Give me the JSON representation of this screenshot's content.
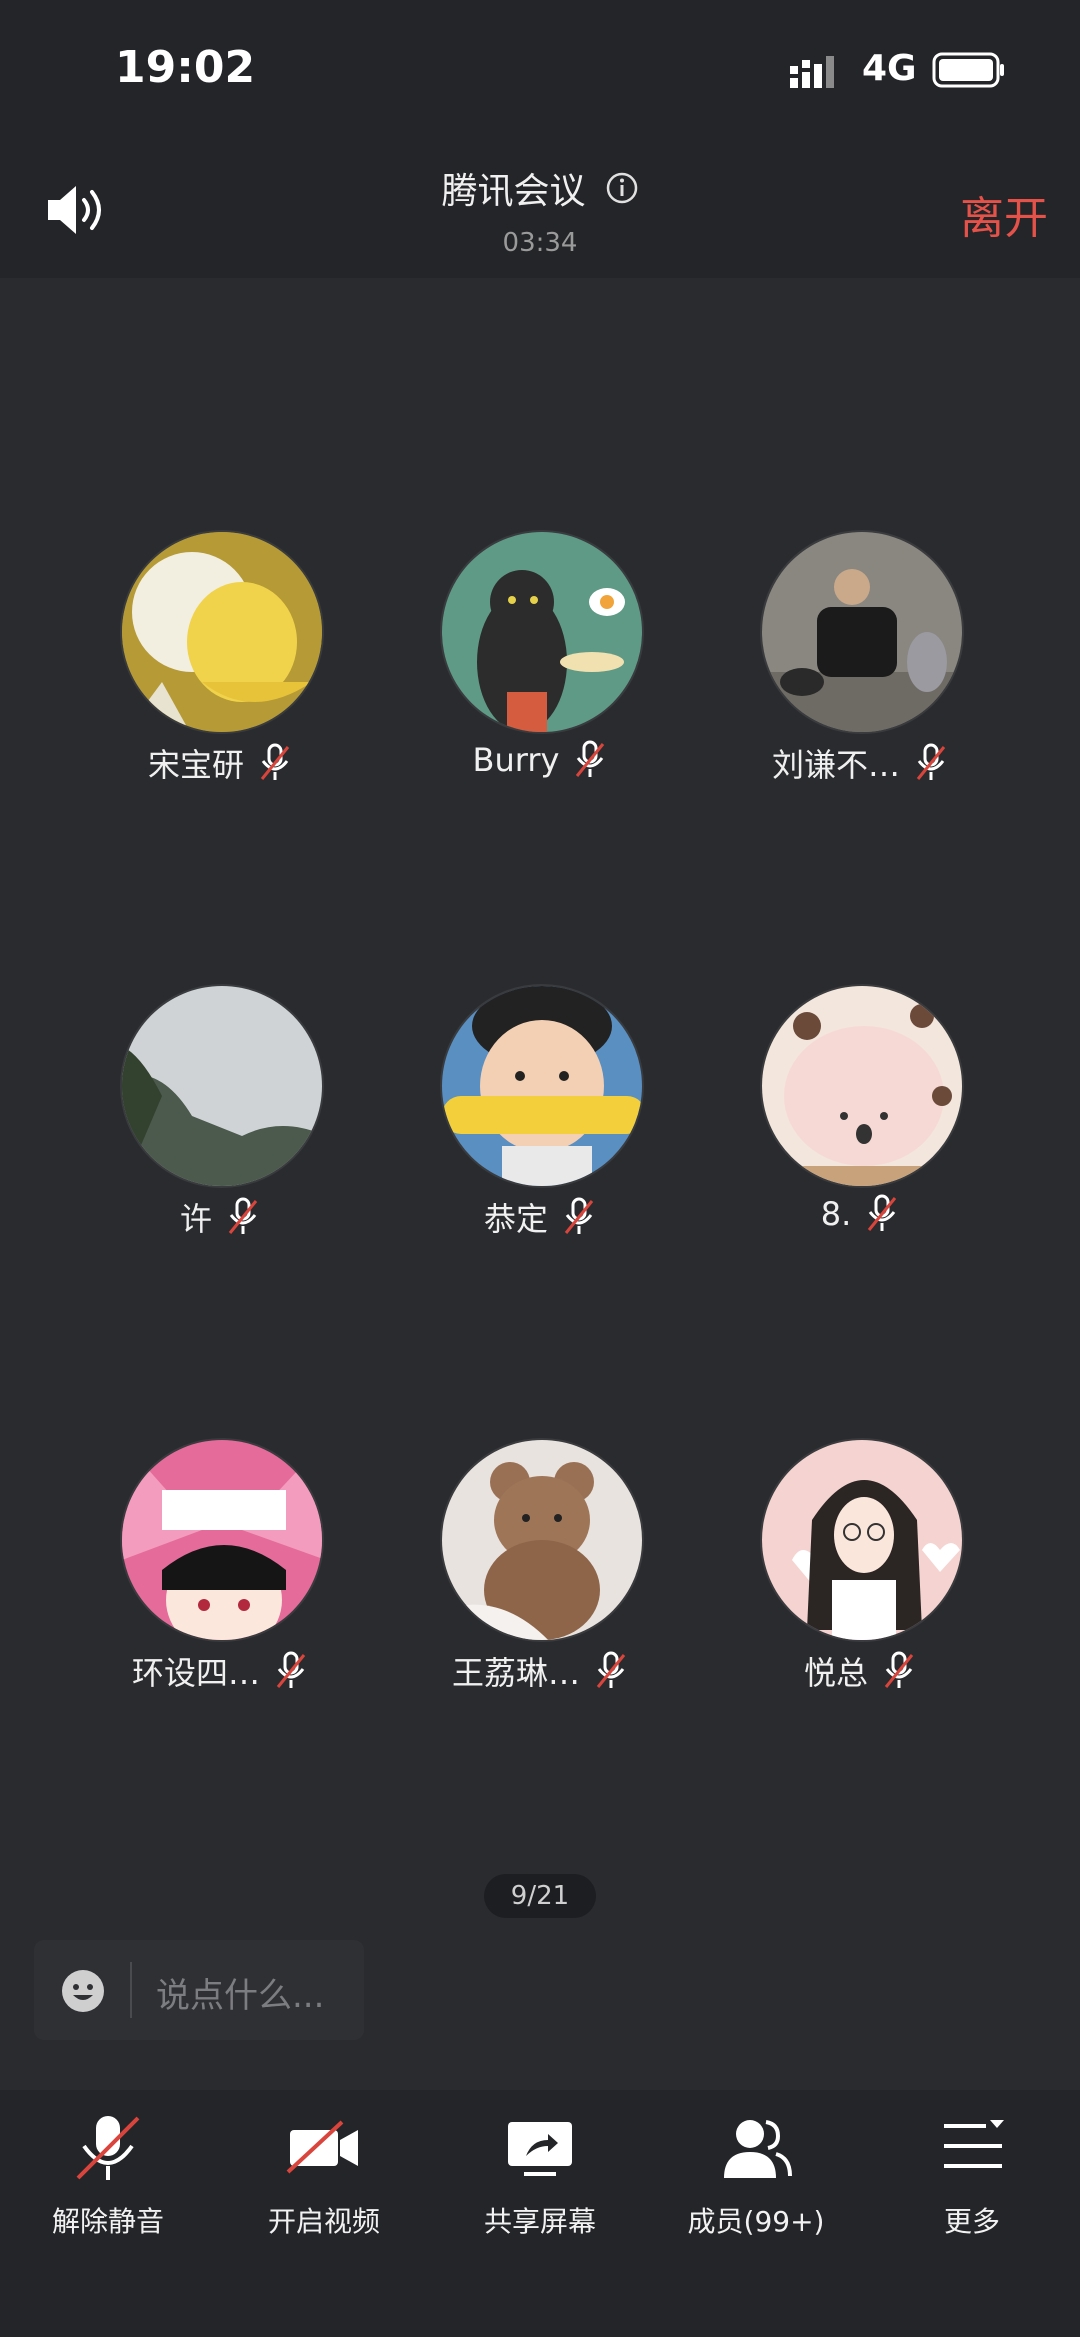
{
  "status": {
    "time": "19:02",
    "network": "4G"
  },
  "header": {
    "title": "腾讯会议",
    "duration": "03:34",
    "leave_label": "离开"
  },
  "participants": [
    {
      "name": "宋宝研",
      "muted": true
    },
    {
      "name": "Burry",
      "muted": true
    },
    {
      "name": "刘谦不…",
      "muted": true
    },
    {
      "name": "许",
      "muted": true
    },
    {
      "name": "恭定",
      "muted": true
    },
    {
      "name": "8.",
      "muted": true
    },
    {
      "name": "环设四…",
      "muted": true
    },
    {
      "name": "王荔琳…",
      "muted": true
    },
    {
      "name": "悦总",
      "muted": true
    }
  ],
  "pagination": {
    "label": "9/21"
  },
  "chat": {
    "placeholder": "说点什么..."
  },
  "toolbar": {
    "unmute_label": "解除静音",
    "video_label": "开启视频",
    "share_label": "共享屏幕",
    "members_label": "成员(99+)",
    "more_label": "更多"
  },
  "colors": {
    "accent_leave": "#e5524a",
    "mute_slash": "#d9453c",
    "background": "#2a2b2e"
  }
}
